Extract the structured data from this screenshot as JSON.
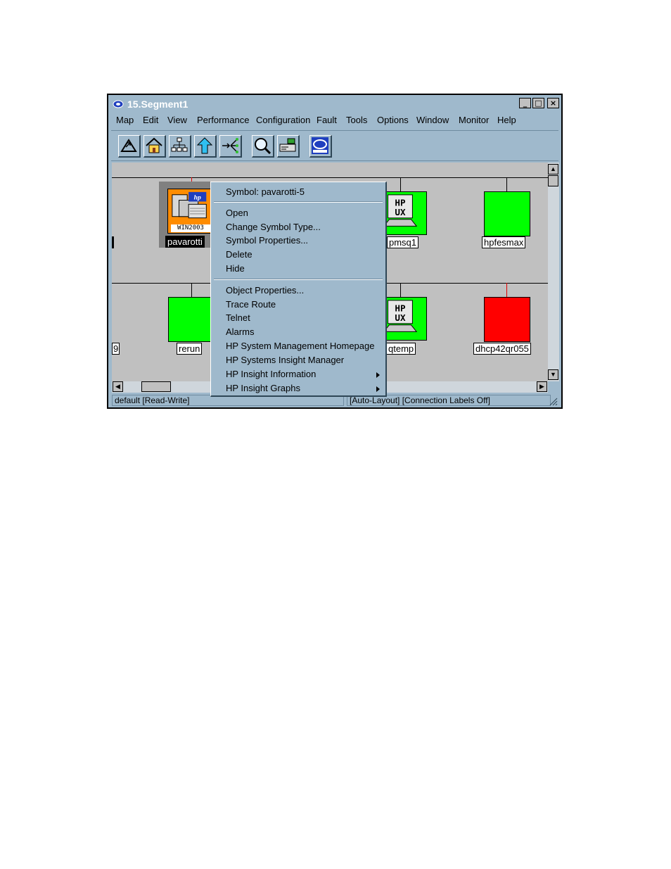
{
  "window": {
    "title": "15.Segment1",
    "controls": {
      "minimize": "_",
      "maximize": "□",
      "close": "×"
    }
  },
  "menubar": {
    "items": [
      "Map",
      "Edit",
      "View",
      "Performance",
      "Configuration",
      "Fault",
      "Tools",
      "Options",
      "Window",
      "Monitor",
      "Help"
    ]
  },
  "toolbar": {
    "tools": [
      "close-submap-icon",
      "home-icon",
      "network-tree-icon",
      "up-arrow-icon",
      "explode-icon",
      "search-icon",
      "monitor-icon",
      "hp-openview-icon"
    ]
  },
  "map": {
    "nodes": [
      {
        "label": "pavarotti",
        "color": "#ff8c00",
        "type": "win2003",
        "badge": "WIN2003",
        "selected": true
      },
      {
        "label": "pmsq1",
        "color": "#00ff00",
        "type": "hpux",
        "badge": "HP UX"
      },
      {
        "label": "hpfesmax",
        "color": "#00ff00",
        "type": "box"
      },
      {
        "label": "9",
        "color": "#00ff00",
        "type": "partial"
      },
      {
        "label": "rerun",
        "color": "#00ff00",
        "type": "box"
      },
      {
        "label": "qtemp",
        "color": "#00ff00",
        "type": "hpux",
        "badge": "HP UX"
      },
      {
        "label": "dhcp42qr055",
        "color": "#ff0000",
        "type": "box"
      }
    ]
  },
  "status": {
    "left": "default [Read-Write]",
    "right": "[Auto-Layout] [Connection Labels Off]"
  },
  "context_menu": {
    "header": "Symbol: pavarotti-5",
    "group1": [
      "Open",
      "Change Symbol Type...",
      "Symbol Properties...",
      "Delete",
      "Hide"
    ],
    "group2": [
      "Object Properties...",
      "Trace Route",
      "Telnet",
      "Alarms",
      "HP System Management Homepage",
      "HP Systems Insight Manager",
      "HP Insight Information",
      "HP Insight Graphs"
    ]
  },
  "colors": {
    "window_bg": "#9fb9cc",
    "map_bg": "#c0c0c0",
    "node_ok": "#00ff00",
    "node_critical": "#ff0000",
    "node_selected": "#ff8c00"
  }
}
